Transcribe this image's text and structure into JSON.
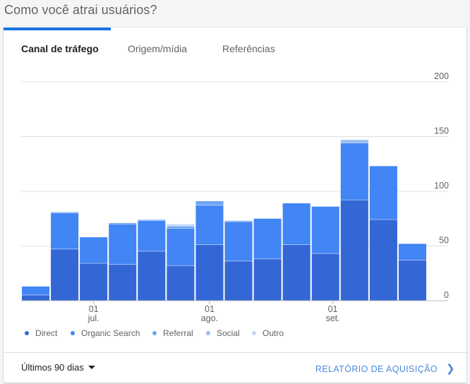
{
  "page": {
    "title": "Como você atrai usuários?"
  },
  "tabs": [
    {
      "label": "Canal de tráfego",
      "active": true
    },
    {
      "label": "Origem/mídia",
      "active": false
    },
    {
      "label": "Referências",
      "active": false
    }
  ],
  "colors": {
    "accent": "#1a73e8",
    "Direct": "#3367d6",
    "Organic Search": "#4285f4",
    "Referral": "#6ea6f5",
    "Social": "#98bdf7",
    "Outro": "#c2d8fb"
  },
  "chart_data": {
    "type": "bar",
    "stacked": true,
    "ylim": [
      0,
      200
    ],
    "yticks": [
      0,
      50,
      100,
      150,
      200
    ],
    "y_axis_side": "right",
    "grid": true,
    "legend_position": "bottom-left",
    "x_tick_labels": [
      {
        "bar_index": 2.5,
        "line1": "01",
        "line2": "jul."
      },
      {
        "bar_index": 6.5,
        "line1": "01",
        "line2": "ago."
      },
      {
        "bar_index": 10.75,
        "line1": "01",
        "line2": "set."
      }
    ],
    "series": [
      {
        "name": "Direct",
        "values": [
          5,
          47,
          34,
          33,
          45,
          32,
          51,
          36,
          38,
          51,
          43,
          92,
          74,
          37
        ]
      },
      {
        "name": "Organic Search",
        "values": [
          8,
          33,
          24,
          37,
          28,
          34,
          36,
          36,
          37,
          38,
          43,
          52,
          49,
          15
        ]
      },
      {
        "name": "Referral",
        "values": [
          0,
          1,
          0,
          1,
          1,
          2,
          4,
          1,
          0,
          0,
          0,
          0,
          0,
          0
        ]
      },
      {
        "name": "Social",
        "values": [
          0,
          0,
          0,
          0,
          0,
          0,
          0,
          0,
          0,
          0,
          0,
          3,
          0,
          0
        ]
      },
      {
        "name": "Outro",
        "values": [
          0,
          0,
          0,
          0,
          0,
          2,
          0,
          0,
          0,
          0,
          0,
          0,
          0,
          0
        ]
      }
    ]
  },
  "footer": {
    "range_label": "Últimos 90 dias",
    "report_link": "RELATÓRIO DE AQUISIÇÃO"
  }
}
